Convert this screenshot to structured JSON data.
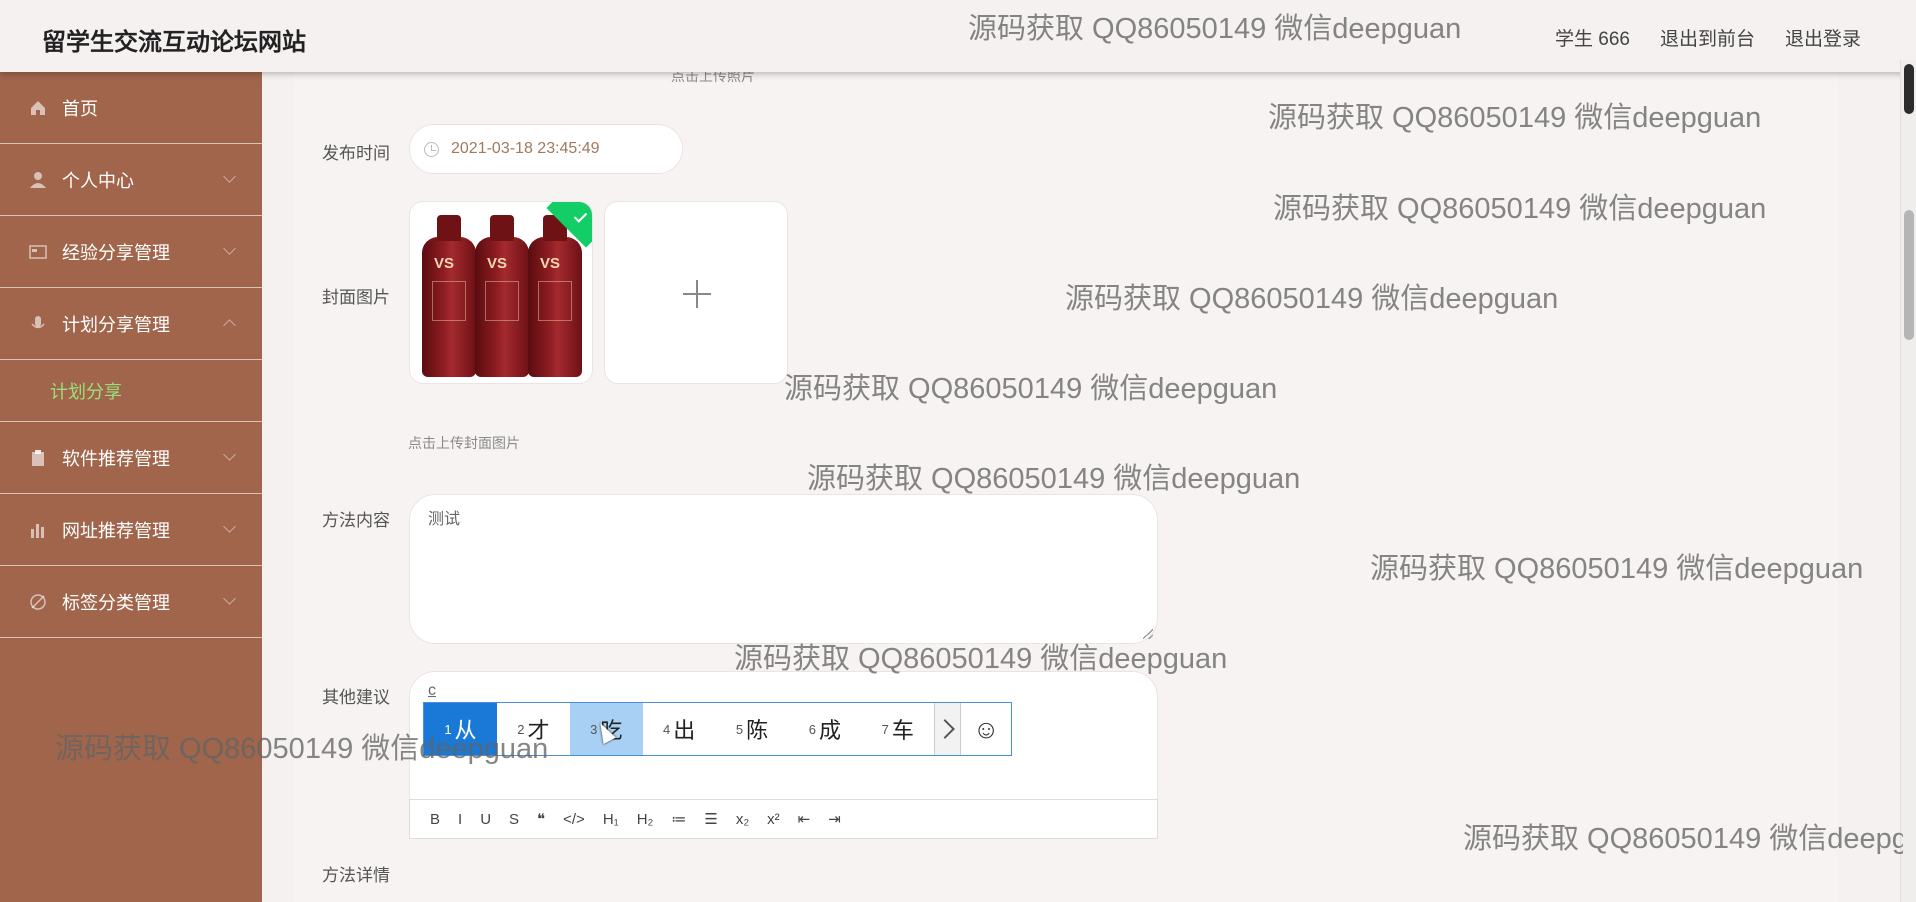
{
  "header": {
    "app_title": "留学生交流互动论坛网站",
    "user": "学生 666",
    "back_to_front": "退出到前台",
    "logout": "退出登录"
  },
  "sidebar": {
    "items": [
      {
        "label": "首页",
        "icon": "home-icon"
      },
      {
        "label": "个人中心",
        "icon": "user-icon"
      },
      {
        "label": "经验分享管理",
        "icon": "card-icon"
      },
      {
        "label": "计划分享管理",
        "icon": "microphone-icon"
      },
      {
        "label": "软件推荐管理",
        "icon": "clipboard-icon"
      },
      {
        "label": "网址推荐管理",
        "icon": "bar-chart-icon"
      },
      {
        "label": "标签分类管理",
        "icon": "tag-icon"
      }
    ],
    "submenu": {
      "label": "计划分享"
    },
    "submenu_color": "#9be07a"
  },
  "form": {
    "top_hint": "点击上传照片",
    "publish_time": {
      "label": "发布时间",
      "value": "2021-03-18 23:45:49"
    },
    "cover": {
      "label": "封面图片",
      "hint": "点击上传封面图片",
      "thumb_text": "VS"
    },
    "method_content": {
      "label": "方法内容",
      "value": "测试"
    },
    "other_suggestions": {
      "label": "其他建议",
      "value": "c"
    },
    "method_details": {
      "label": "方法详情"
    }
  },
  "editor_toolbar": [
    "B",
    "I",
    "U",
    "S",
    "❝",
    "</>",
    "H₁",
    "H₂",
    "≔",
    "☰",
    "x₂",
    "x²",
    "⇤",
    "⇥"
  ],
  "ime": {
    "candidates": [
      {
        "num": "1",
        "text": "从"
      },
      {
        "num": "2",
        "text": "才"
      },
      {
        "num": "3",
        "text": "吃"
      },
      {
        "num": "4",
        "text": "出"
      },
      {
        "num": "5",
        "text": "陈"
      },
      {
        "num": "6",
        "text": "成"
      },
      {
        "num": "7",
        "text": "车"
      }
    ],
    "emoji": "☺"
  },
  "watermark": "源码获取 QQ86050149 微信deepguan",
  "colors": {
    "sidebar": "#a0654b",
    "accent": "#1a78d6",
    "success": "#13ce66"
  }
}
